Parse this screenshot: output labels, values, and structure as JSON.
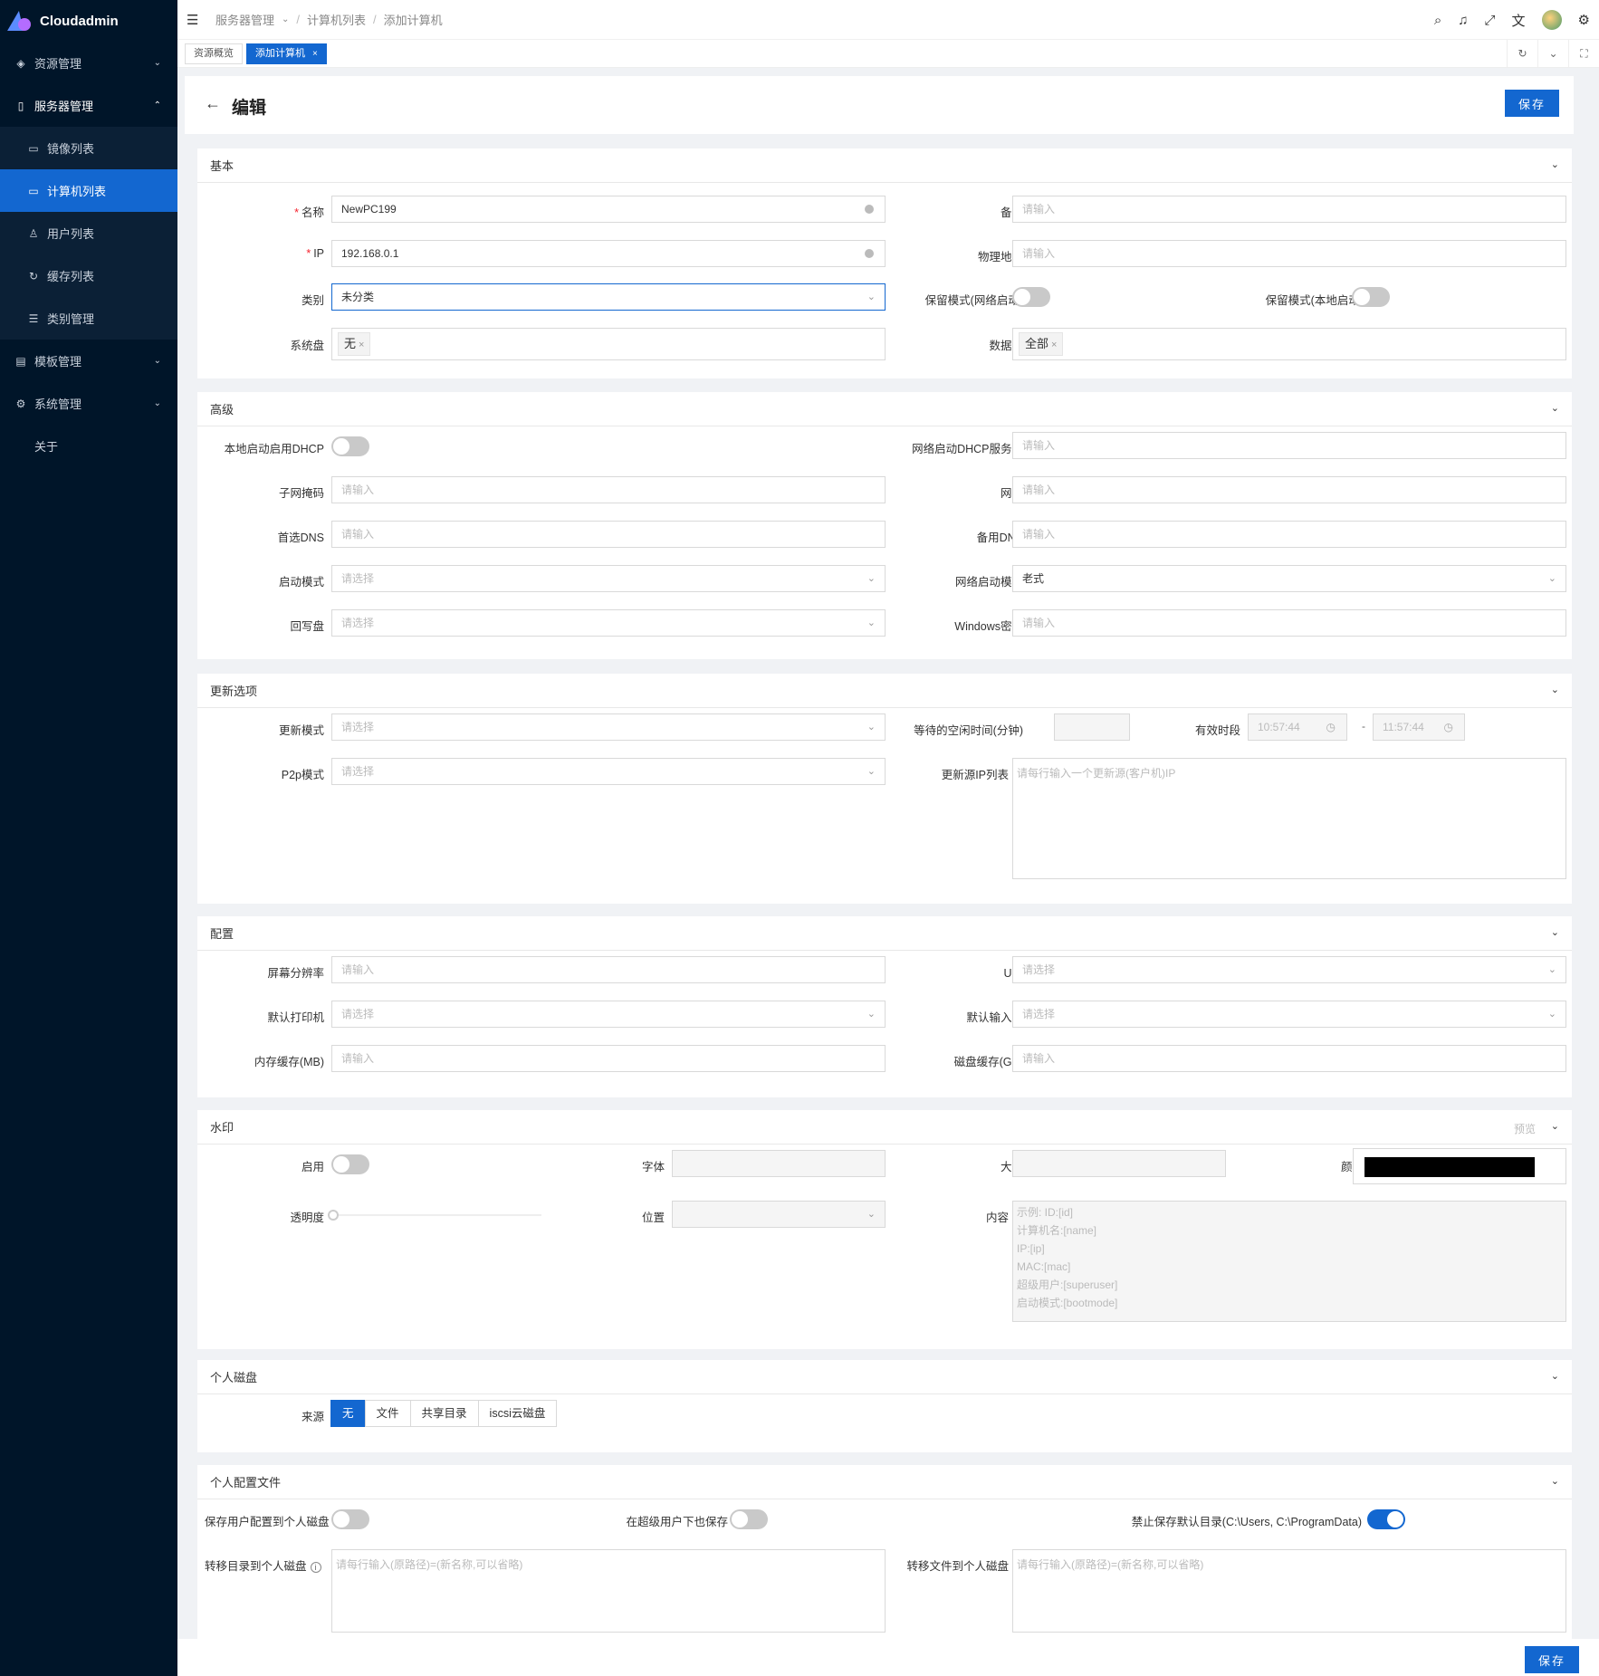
{
  "app": {
    "name": "Cloudadmin"
  },
  "sidebar": {
    "items": [
      {
        "label": "资源管理",
        "icon": "resource-icon"
      },
      {
        "label": "服务器管理",
        "icon": "server-icon"
      },
      {
        "label": "模板管理",
        "icon": "template-icon"
      },
      {
        "label": "系统管理",
        "icon": "gear-icon"
      },
      {
        "label": "关于",
        "icon": ""
      }
    ],
    "sub_items": [
      {
        "label": "镜像列表",
        "icon": "image-icon"
      },
      {
        "label": "计算机列表",
        "icon": "monitor-icon"
      },
      {
        "label": "用户列表",
        "icon": "user-icon"
      },
      {
        "label": "缓存列表",
        "icon": "cache-icon"
      },
      {
        "label": "类别管理",
        "icon": "list-icon"
      }
    ]
  },
  "header": {
    "breadcrumb": [
      "服务器管理",
      "计算机列表",
      "添加计算机"
    ]
  },
  "tabs": [
    {
      "label": "资源概览"
    },
    {
      "label": "添加计算机"
    }
  ],
  "page": {
    "title": "编辑",
    "save_label": "保存"
  },
  "basic": {
    "title": "基本",
    "name_label": "名称",
    "name_value": "NewPC199",
    "note_label": "备注",
    "note_placeholder": "请输入",
    "ip_label": "IP",
    "ip_value": "192.168.0.1",
    "mac_label": "物理地址",
    "mac_placeholder": "请输入",
    "category_label": "类别",
    "category_value": "未分类",
    "keep_net_label": "保留模式(网络启动)",
    "keep_local_label": "保留模式(本地启动)",
    "sysdisk_label": "系统盘",
    "sysdisk_tag": "无",
    "datadisk_label": "数据盘",
    "datadisk_tag": "全部"
  },
  "advanced": {
    "title": "高级",
    "dhcp_label": "本地启动启用DHCP",
    "dhcp_server_label": "网络启动DHCP服务器",
    "dhcp_server_placeholder": "请输入",
    "mask_label": "子网掩码",
    "mask_placeholder": "请输入",
    "gateway_label": "网关",
    "gateway_placeholder": "请输入",
    "dns1_label": "首选DNS",
    "dns1_placeholder": "请输入",
    "dns2_label": "备用DNS",
    "dns2_placeholder": "请输入",
    "bootmode_label": "启动模式",
    "bootmode_placeholder": "请选择",
    "netboot_label": "网络启动模式",
    "netboot_value": "老式",
    "writeback_label": "回写盘",
    "writeback_placeholder": "请选择",
    "winkey_label": "Windows密钥",
    "winkey_placeholder": "请输入"
  },
  "update": {
    "title": "更新选项",
    "mode_label": "更新模式",
    "mode_placeholder": "请选择",
    "idle_label": "等待的空闲时间(分钟)",
    "period_label": "有效时段",
    "time_start": "10:57:44",
    "time_end": "11:57:44",
    "time_sep": "-",
    "p2p_label": "P2p模式",
    "p2p_placeholder": "请选择",
    "srcip_label": "更新源IP列表",
    "srcip_placeholder": "请每行输入一个更新源(客户机)IP"
  },
  "config": {
    "title": "配置",
    "resolution_label": "屏幕分辨率",
    "resolution_placeholder": "请输入",
    "udisk_label": "U盘",
    "udisk_placeholder": "请选择",
    "printer_label": "默认打印机",
    "printer_placeholder": "请选择",
    "ime_label": "默认输入法",
    "ime_placeholder": "请选择",
    "memcache_label": "内存缓存(MB)",
    "memcache_placeholder": "请输入",
    "diskcache_label": "磁盘缓存(GB)",
    "diskcache_placeholder": "请输入"
  },
  "watermark": {
    "title": "水印",
    "preview_label": "预览",
    "enable_label": "启用",
    "font_label": "字体",
    "size_label": "大小",
    "color_label": "颜色",
    "color_value": "#000000",
    "opacity_label": "透明度",
    "opacity_value": 0,
    "position_label": "位置",
    "content_label": "内容",
    "content_lines": [
      "示例: ID:[id]",
      "计算机名:[name]",
      "IP:[ip]",
      "MAC:[mac]",
      "超级用户:[superuser]",
      "启动模式:[bootmode]"
    ]
  },
  "personal_disk": {
    "title": "个人磁盘",
    "source_label": "来源",
    "options": [
      "无",
      "文件",
      "共享目录",
      "iscsi云磁盘"
    ]
  },
  "profile": {
    "title": "个人配置文件",
    "save_cfg_label": "保存用户配置到个人磁盘",
    "super_label": "在超级用户下也保存",
    "forbid_label": "禁止保存默认目录(C:\\Users, C:\\ProgramData)",
    "move_dir_label": "转移目录到个人磁盘",
    "move_dir_placeholder": "请每行输入(原路径)=(新名称,可以省略)",
    "move_file_label": "转移文件到个人磁盘",
    "move_file_placeholder": "请每行输入(原路径)=(新名称,可以省略)"
  },
  "colors": {
    "primary": "#1367d0",
    "sidebar_bg": "#001529"
  }
}
